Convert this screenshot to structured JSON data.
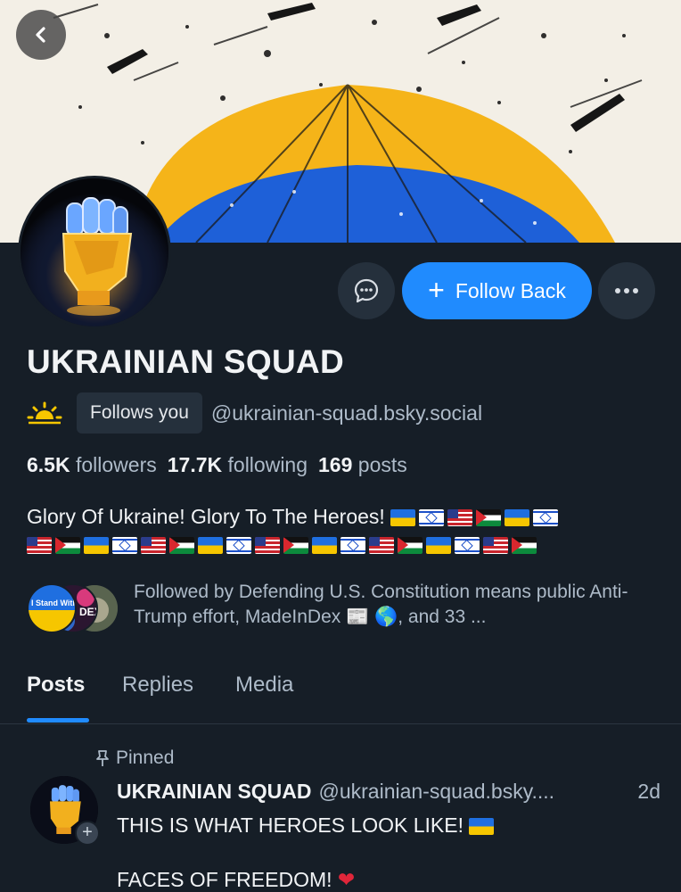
{
  "profile": {
    "display_name": "UKRAINIAN SQUAD",
    "follows_you": "Follows you",
    "handle": "@ukrainian-squad.bsky.social",
    "followers_count": "6.5K",
    "followers_label": "followers",
    "following_count": "17.7K",
    "following_label": "following",
    "posts_count": "169",
    "posts_label": "posts",
    "bio_text": "Glory Of Ukraine! Glory To The Heroes!",
    "bio_flags_line1": [
      "ukraine-flag",
      "israel-flag",
      "usa-flag",
      "palestine-flag",
      "ukraine-flag",
      "israel-flag"
    ],
    "bio_flags_line2": [
      "usa-flag",
      "palestine-flag",
      "ukraine-flag",
      "israel-flag",
      "usa-flag",
      "palestine-flag",
      "ukraine-flag",
      "israel-flag",
      "usa-flag",
      "palestine-flag",
      "ukraine-flag",
      "israel-flag",
      "usa-flag",
      "palestine-flag",
      "ukraine-flag",
      "israel-flag",
      "usa-flag",
      "palestine-flag"
    ],
    "followed_by_text": "Followed by Defending U.S. Constitution means public Anti-Trump effort, MadeInDex 📰 🌎, and 33 ...",
    "followed_by_avatar_1_text": "I Stand With UKRAINE",
    "followed_by_avatar_2_text": "DEX"
  },
  "actions": {
    "follow_back": "Follow Back",
    "follow_icon": "plus-icon",
    "message_icon": "chat-bubble-icon",
    "more_icon": "ellipsis-icon",
    "back_icon": "chevron-left-icon"
  },
  "tabs": [
    {
      "label": "Posts",
      "active": true
    },
    {
      "label": "Replies",
      "active": false
    },
    {
      "label": "Media",
      "active": false
    }
  ],
  "pinned_post": {
    "pinned_label": "Pinned",
    "author": "UKRAINIAN SQUAD",
    "handle": "@ukrainian-squad.bsky....",
    "time": "2d",
    "line1": "THIS IS WHAT HEROES LOOK LIKE!",
    "line2": "FACES OF FREEDOM!"
  },
  "colors": {
    "background": "#161e27",
    "accent": "#208bfe",
    "ukraine_blue": "#1f6fe0",
    "ukraine_yellow": "#f6c600",
    "muted_text": "#aebbc9"
  }
}
